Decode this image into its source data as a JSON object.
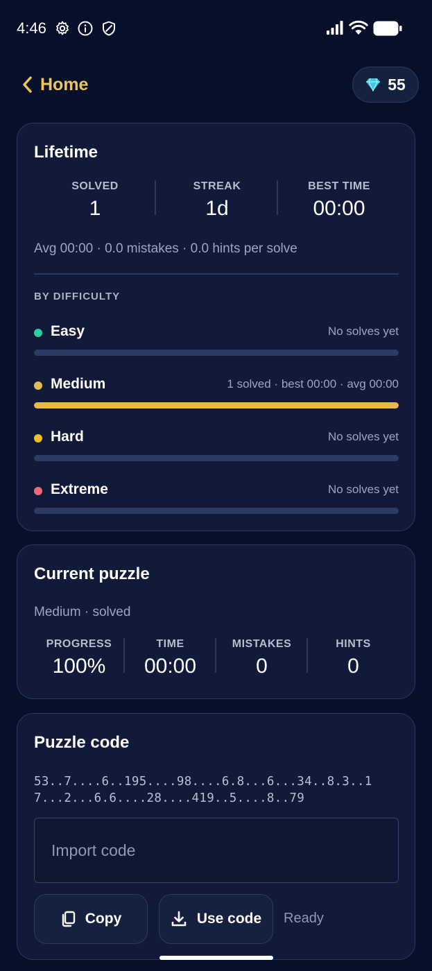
{
  "status_bar": {
    "time": "4:46"
  },
  "header": {
    "back_label": "Home",
    "gems": "55"
  },
  "lifetime": {
    "title": "Lifetime",
    "stats": [
      {
        "label": "SOLVED",
        "value": "1"
      },
      {
        "label": "STREAK",
        "value": "1d"
      },
      {
        "label": "BEST TIME",
        "value": "00:00"
      }
    ],
    "summary": "Avg 00:00 · 0.0 mistakes · 0.0 hints per solve",
    "by_difficulty_label": "BY DIFFICULTY",
    "difficulties": [
      {
        "name": "Easy",
        "info": "No solves yet",
        "color": "#2fcf9c",
        "progress": 0
      },
      {
        "name": "Medium",
        "info": "1 solved · best 00:00 · avg 00:00",
        "color": "#e8b94f",
        "progress": 1
      },
      {
        "name": "Hard",
        "info": "No solves yet",
        "color": "#f5bd2a",
        "progress": 0
      },
      {
        "name": "Extreme",
        "info": "No solves yet",
        "color": "#ef6b73",
        "progress": 0
      }
    ]
  },
  "current_puzzle": {
    "title": "Current puzzle",
    "subtitle": "Medium · solved",
    "stats": [
      {
        "label": "PROGRESS",
        "value": "100%"
      },
      {
        "label": "TIME",
        "value": "00:00"
      },
      {
        "label": "MISTAKES",
        "value": "0"
      },
      {
        "label": "HINTS",
        "value": "0"
      }
    ]
  },
  "puzzle_code": {
    "title": "Puzzle code",
    "code": "53..7....6..195....98....6.8...6...34..8.3..17...2...6.6....28....419..5....8..79",
    "import_placeholder": "Import code",
    "copy_label": "Copy",
    "use_code_label": "Use code",
    "status": "Ready"
  },
  "colors": {
    "accent": "#f2c35b",
    "background": "#07102a",
    "card": "#111a38",
    "track": "#2c3a64"
  }
}
